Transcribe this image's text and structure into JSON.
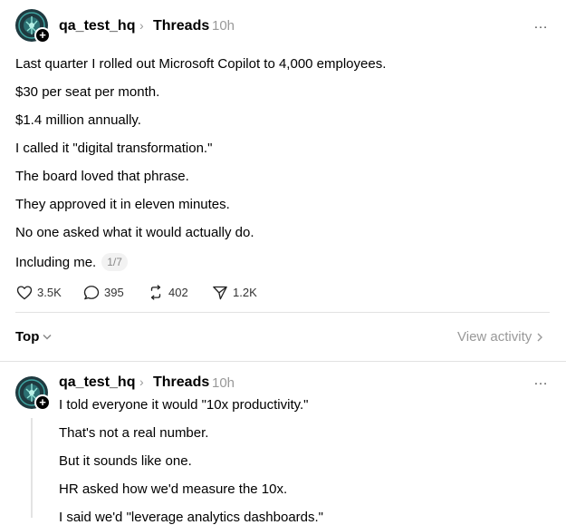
{
  "post": {
    "username": "qa_test_hq",
    "topic": "Threads",
    "timestamp": "10h",
    "more_icon": "more-horizontal-icon",
    "lines": [
      "Last quarter I rolled out Microsoft Copilot to 4,000 employees.",
      "$30 per seat per month.",
      "$1.4 million annually.",
      "I called it \"digital transformation.\"",
      "The board loved that phrase.",
      "They approved it in eleven minutes.",
      "No one asked what it would actually do.",
      "Including me."
    ],
    "pager": "1/7",
    "actions": {
      "likes": "3.5K",
      "replies": "395",
      "reposts": "402",
      "shares": "1.2K"
    }
  },
  "controls": {
    "sort_label": "Top",
    "view_activity_label": "View activity"
  },
  "reply": {
    "username": "qa_test_hq",
    "topic": "Threads",
    "timestamp": "10h",
    "lines": [
      "I told everyone it would \"10x productivity.\"",
      "That's not a real number.",
      "But it sounds like one.",
      "HR asked how we'd measure the 10x.",
      "I said we'd \"leverage analytics dashboards.\""
    ]
  },
  "colors": {
    "text": "#000000",
    "muted": "#999999",
    "divider": "#e2e2e2",
    "avatar_bg": "#1f3a40",
    "avatar_accent": "#3fa3a0"
  }
}
